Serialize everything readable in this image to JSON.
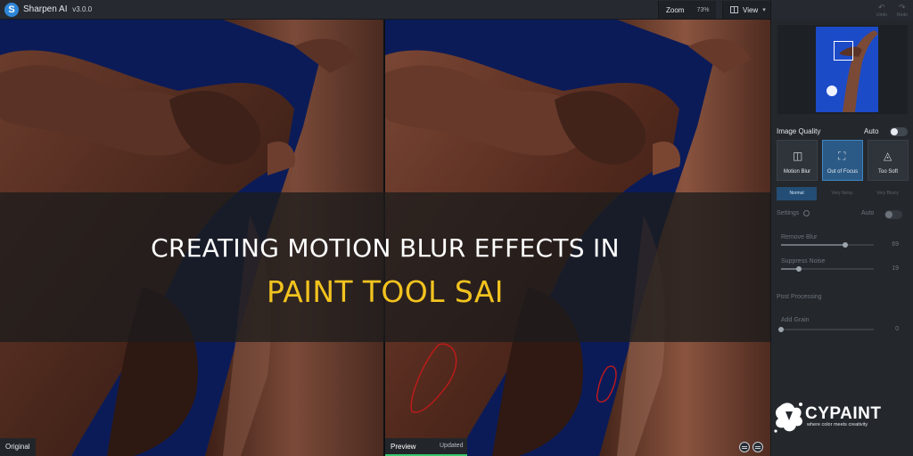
{
  "titlebar": {
    "logo_letter": "S",
    "app_name": "Sharpen AI",
    "version": "v3.0.0",
    "zoom_label": "Zoom",
    "zoom_value": "73%",
    "view_label": "View"
  },
  "canvas": {
    "original_label": "Original",
    "preview_label": "Preview",
    "updated_label": "Updated"
  },
  "panel": {
    "undo_label": "Undo",
    "redo_label": "Redo",
    "image_quality_label": "Image Quality",
    "image_quality_auto_label": "Auto",
    "modes": [
      {
        "label": "Motion Blur",
        "icon": "camera-shake-icon"
      },
      {
        "label": "Out of Focus",
        "icon": "focus-person-icon",
        "active": true
      },
      {
        "label": "Too Soft",
        "icon": "soft-drop-icon"
      }
    ],
    "sub_tabs": [
      "Normal",
      "Very Noisy",
      "Very Blurry"
    ],
    "settings_label": "Settings",
    "settings_auto_label": "Auto",
    "sliders": [
      {
        "label": "Remove Blur",
        "value": "69",
        "fraction": 0.69
      },
      {
        "label": "Suppress Noise",
        "value": "19",
        "fraction": 0.19
      }
    ],
    "post_processing_label": "Post Processing",
    "grain": {
      "label": "Add Grain",
      "value": "0",
      "fraction": 0.0
    }
  },
  "headline": {
    "line1": "CREATING MOTION BLUR EFFECTS IN",
    "line2": "PAINT TOOL SAI"
  },
  "brand": {
    "name": "CYPAINT",
    "tagline": "where color meets creativity"
  },
  "colors": {
    "sky": "#0b1b58",
    "accent_green": "#39c66c",
    "active_blue": "#2b5a86",
    "headline_yellow": "#f2c31f"
  }
}
